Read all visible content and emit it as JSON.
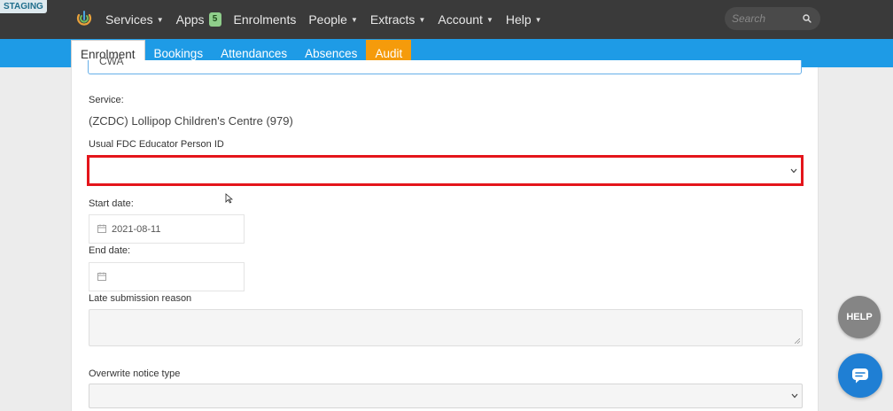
{
  "env_badge": "STAGING",
  "nav": {
    "items": [
      {
        "label": "Services",
        "caret": true
      },
      {
        "label": "Apps",
        "badge": "5"
      },
      {
        "label": "Enrolments",
        "caret": false
      },
      {
        "label": "People",
        "caret": true
      },
      {
        "label": "Extracts",
        "caret": true
      },
      {
        "label": "Account",
        "caret": true
      },
      {
        "label": "Help",
        "caret": true
      }
    ],
    "search_placeholder": "Search"
  },
  "tabs": [
    "Enrolment",
    "Bookings",
    "Attendances",
    "Absences",
    "Audit"
  ],
  "form": {
    "previous_field_value": "CWA",
    "service_label": "Service:",
    "service_value": "(ZCDC) Lollipop Children's Centre (979)",
    "educator_label": "Usual FDC Educator Person ID",
    "educator_value": "",
    "start_date_label": "Start date:",
    "start_date_value": "2021-08-11",
    "end_date_label": "End date:",
    "end_date_value": "",
    "late_reason_label": "Late submission reason",
    "overwrite_label": "Overwrite notice type",
    "overwrite_value": ""
  },
  "help_button_label": "HELP",
  "colors": {
    "nav_bg": "#3a3a3a",
    "tab_bar": "#1e9be6",
    "audit_tab": "#f59b0b",
    "highlight_border": "#e4151b",
    "chat_button": "#1f7fd4"
  }
}
